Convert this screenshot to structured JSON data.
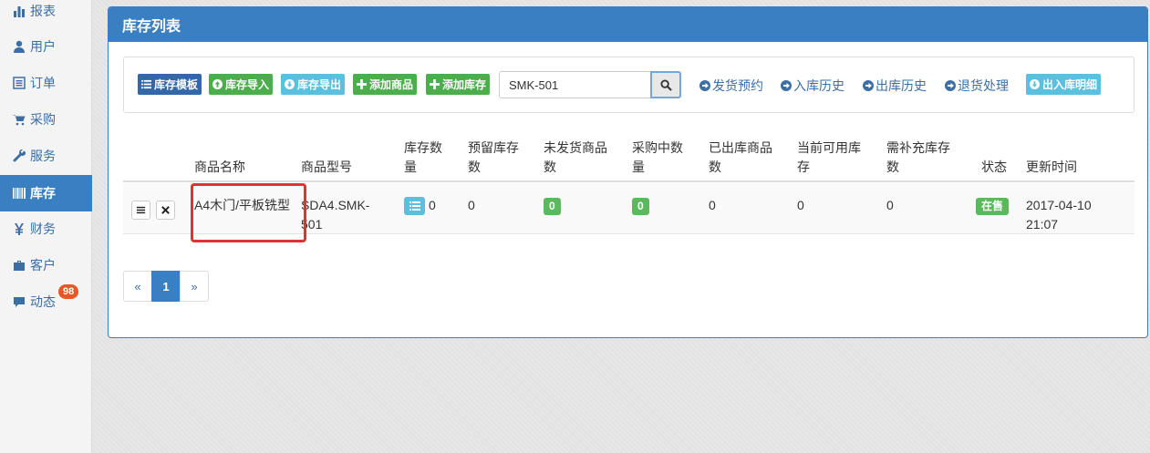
{
  "sidebar": {
    "items": [
      {
        "label": "报表",
        "icon": "bar-chart-icon"
      },
      {
        "label": "用户",
        "icon": "user-icon"
      },
      {
        "label": "订单",
        "icon": "list-icon"
      },
      {
        "label": "采购",
        "icon": "cart-icon"
      },
      {
        "label": "服务",
        "icon": "wrench-icon"
      },
      {
        "label": "库存",
        "icon": "barcode-icon",
        "active": true
      },
      {
        "label": "财务",
        "icon": "yen-icon"
      },
      {
        "label": "客户",
        "icon": "briefcase-icon"
      },
      {
        "label": "动态",
        "icon": "comment-icon",
        "badge": "98"
      }
    ]
  },
  "panel": {
    "title": "库存列表"
  },
  "toolbar": {
    "inventory_template": "库存模板",
    "import_stock": "库存导入",
    "export_stock": "库存导出",
    "add_product": "添加商品",
    "add_stock": "添加库存",
    "search_value": "SMK-501",
    "links": {
      "shipping_reservation": "发货预约",
      "inbound_history": "入库历史",
      "outbound_history": "出库历史",
      "returns": "退货处理"
    },
    "io_detail": "出入库明细"
  },
  "table": {
    "headers": {
      "name": "商品名称",
      "model": "商品型号",
      "stock": "库存数量",
      "reserved": "预留库存数",
      "unshipped": "未发货商品数",
      "purchasing": "采购中数量",
      "shipped": "已出库商品数",
      "available": "当前可用库存",
      "restock": "需补充库存数",
      "status": "状态",
      "updated": "更新时间"
    },
    "rows": [
      {
        "name": "A4木门/平板铣型",
        "model": "SDA4.SMK-501",
        "stock": "0",
        "reserved": "0",
        "unshipped": "0",
        "purchasing": "0",
        "shipped": "0",
        "available": "0",
        "restock": "0",
        "status": "在售",
        "updated": "2017-04-10 21:07"
      }
    ]
  },
  "pagination": {
    "prev": "«",
    "current": "1",
    "next": "»"
  },
  "colors": {
    "primary": "#3a7fc1",
    "success": "#4cad4c",
    "info": "#5bc0de",
    "highlight": "#e03232",
    "badge": "#e8572a"
  }
}
